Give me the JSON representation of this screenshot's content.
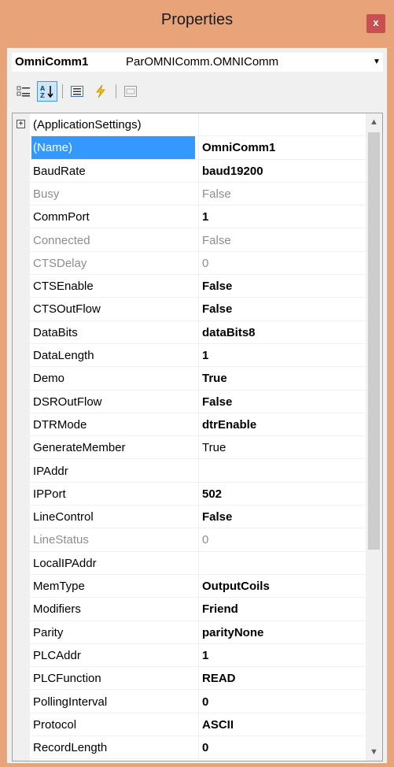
{
  "window": {
    "title": "Properties",
    "close_label": "x"
  },
  "selector": {
    "object_name": "OmniComm1",
    "object_type": "ParOMNIComm.OMNIComm"
  },
  "toolbar": {
    "buttons": [
      {
        "name": "categorized",
        "icon": "categorized-icon"
      },
      {
        "name": "alphabetical",
        "icon": "alphabetical-icon",
        "active": true
      },
      {
        "name": "properties",
        "icon": "properties-icon"
      },
      {
        "name": "events",
        "icon": "events-icon"
      },
      {
        "name": "property-pages",
        "icon": "property-pages-icon"
      }
    ]
  },
  "grid": {
    "rows": [
      {
        "name": "(ApplicationSettings)",
        "value": "",
        "expander": "⊞"
      },
      {
        "name": "(Name)",
        "value": "OmniComm1",
        "bold": true,
        "selected": true
      },
      {
        "name": "BaudRate",
        "value": "baud19200",
        "bold": true
      },
      {
        "name": "Busy",
        "value": "False",
        "disabled": true
      },
      {
        "name": "CommPort",
        "value": "1",
        "bold": true
      },
      {
        "name": "Connected",
        "value": "False",
        "disabled": true
      },
      {
        "name": "CTSDelay",
        "value": "0",
        "disabled": true
      },
      {
        "name": "CTSEnable",
        "value": "False",
        "bold": true
      },
      {
        "name": "CTSOutFlow",
        "value": "False",
        "bold": true
      },
      {
        "name": "DataBits",
        "value": "dataBits8",
        "bold": true
      },
      {
        "name": "DataLength",
        "value": "1",
        "bold": true
      },
      {
        "name": "Demo",
        "value": "True",
        "bold": true
      },
      {
        "name": "DSROutFlow",
        "value": "False",
        "bold": true
      },
      {
        "name": "DTRMode",
        "value": "dtrEnable",
        "bold": true
      },
      {
        "name": "GenerateMember",
        "value": "True"
      },
      {
        "name": "IPAddr",
        "value": ""
      },
      {
        "name": "IPPort",
        "value": "502",
        "bold": true
      },
      {
        "name": "LineControl",
        "value": "False",
        "bold": true
      },
      {
        "name": "LineStatus",
        "value": "0",
        "disabled": true
      },
      {
        "name": "LocalIPAddr",
        "value": ""
      },
      {
        "name": "MemType",
        "value": "OutputCoils",
        "bold": true
      },
      {
        "name": "Modifiers",
        "value": "Friend",
        "bold": true
      },
      {
        "name": "Parity",
        "value": "parityNone",
        "bold": true
      },
      {
        "name": "PLCAddr",
        "value": "1",
        "bold": true
      },
      {
        "name": "PLCFunction",
        "value": "READ",
        "bold": true
      },
      {
        "name": "PollingInterval",
        "value": "0",
        "bold": true
      },
      {
        "name": "Protocol",
        "value": "ASCII",
        "bold": true
      },
      {
        "name": "RecordLength",
        "value": "0",
        "bold": true
      }
    ]
  }
}
